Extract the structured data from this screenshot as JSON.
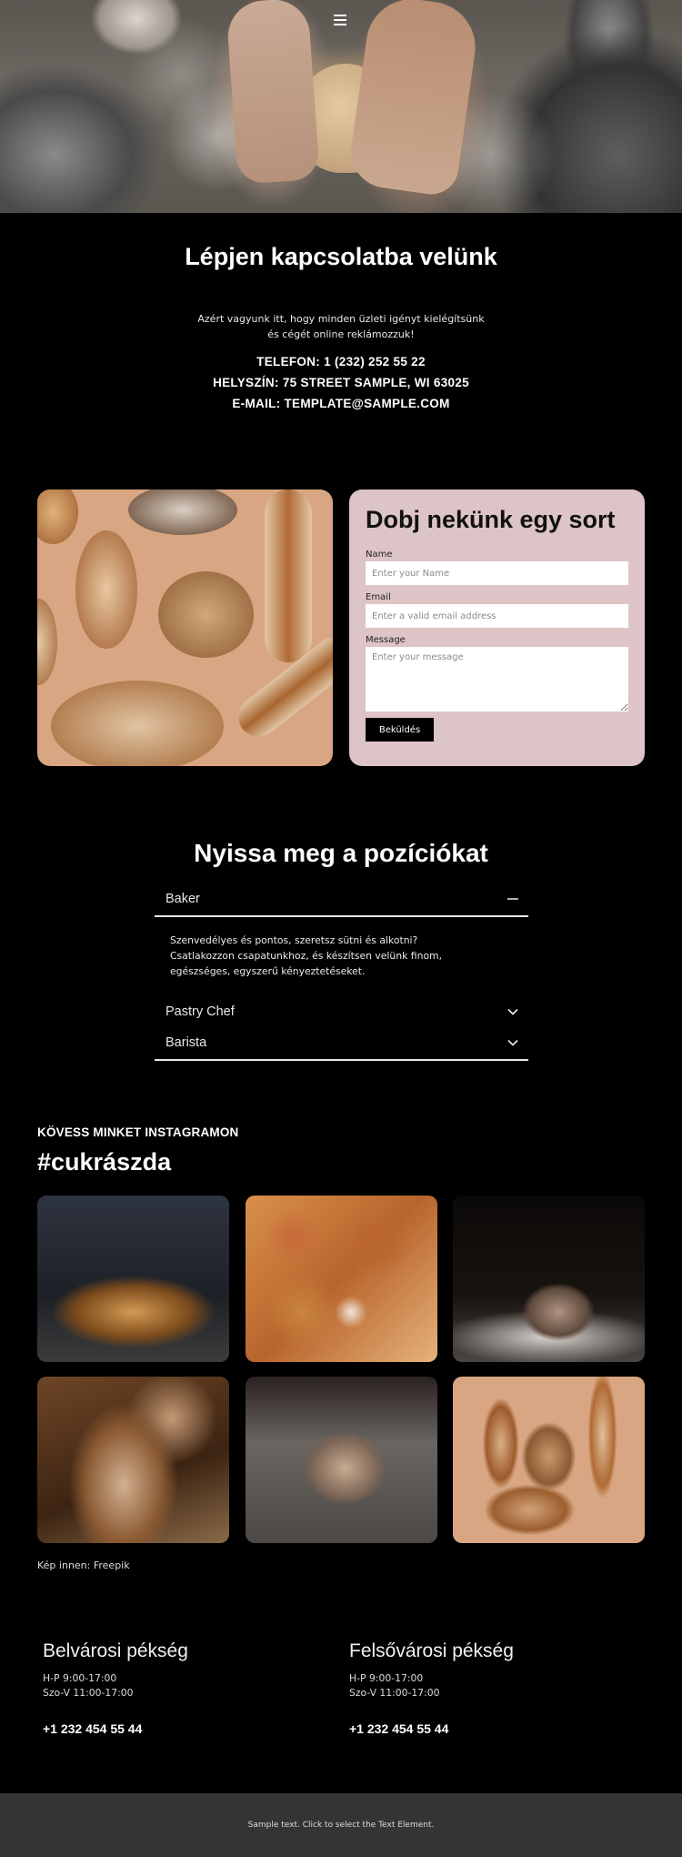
{
  "header": {
    "menu_icon": "hamburger-menu-icon",
    "hero_image": "hands kneading dough on floured table"
  },
  "contact": {
    "title": "Lépjen kapcsolatba velünk",
    "intro": "Azért vagyunk itt, hogy minden üzleti igényt kielégítsünk és cégét online reklámozzuk!",
    "phone": "TELEFON: 1 (232) 252 55 22",
    "location": "HELYSZÍN: 75 STREET SAMPLE, WI 63025",
    "email": "E-MAIL: TEMPLATE@SAMPLE.COM"
  },
  "form": {
    "image": "assorted bread loaves on beige background",
    "title": "Dobj nekünk egy sort",
    "name_label": "Name",
    "name_placeholder": "Enter your Name",
    "email_label": "Email",
    "email_placeholder": "Enter a valid email address",
    "message_label": "Message",
    "message_placeholder": "Enter your message",
    "submit_label": "Beküldés",
    "panel_color": "#ddc4c6"
  },
  "positions": {
    "title": "Nyissa meg a pozíciókat",
    "items": [
      {
        "label": "Baker",
        "expanded": true,
        "icon": "minus-icon",
        "body": "Szenvedélyes és pontos, szeretsz sütni és alkotni? Csatlakozzon csapatunkhoz, és készítsen velünk finom, egészséges, egyszerű kényeztetéseket."
      },
      {
        "label": "Pastry Chef",
        "expanded": false,
        "icon": "chevron-down-icon"
      },
      {
        "label": "Barista",
        "expanded": false,
        "icon": "chevron-down-icon"
      }
    ]
  },
  "instagram": {
    "kicker": "KÖVESS MINKET INSTAGRAMON",
    "hashtag": "#cukrászda",
    "tiles": [
      "baker holding tray of croissants",
      "assorted pastries top view",
      "flour falling on dough ball",
      "rustic bread loaves with wheat",
      "hands kneading dough",
      "bread loaves on beige background"
    ],
    "credit": "Kép innen: Freepik"
  },
  "locations": [
    {
      "name": "Belvárosi pékség",
      "hours": [
        "H-P 9:00-17:00",
        "Szo-V 11:00-17:00"
      ],
      "phone": "+1 232 454 55 44"
    },
    {
      "name": "Felsővárosi pékség",
      "hours": [
        "H-P 9:00-17:00",
        "Szo-V 11:00-17:00"
      ],
      "phone": "+1 232 454 55 44"
    }
  ],
  "footer": {
    "text": "Sample text. Click to select the Text Element."
  }
}
